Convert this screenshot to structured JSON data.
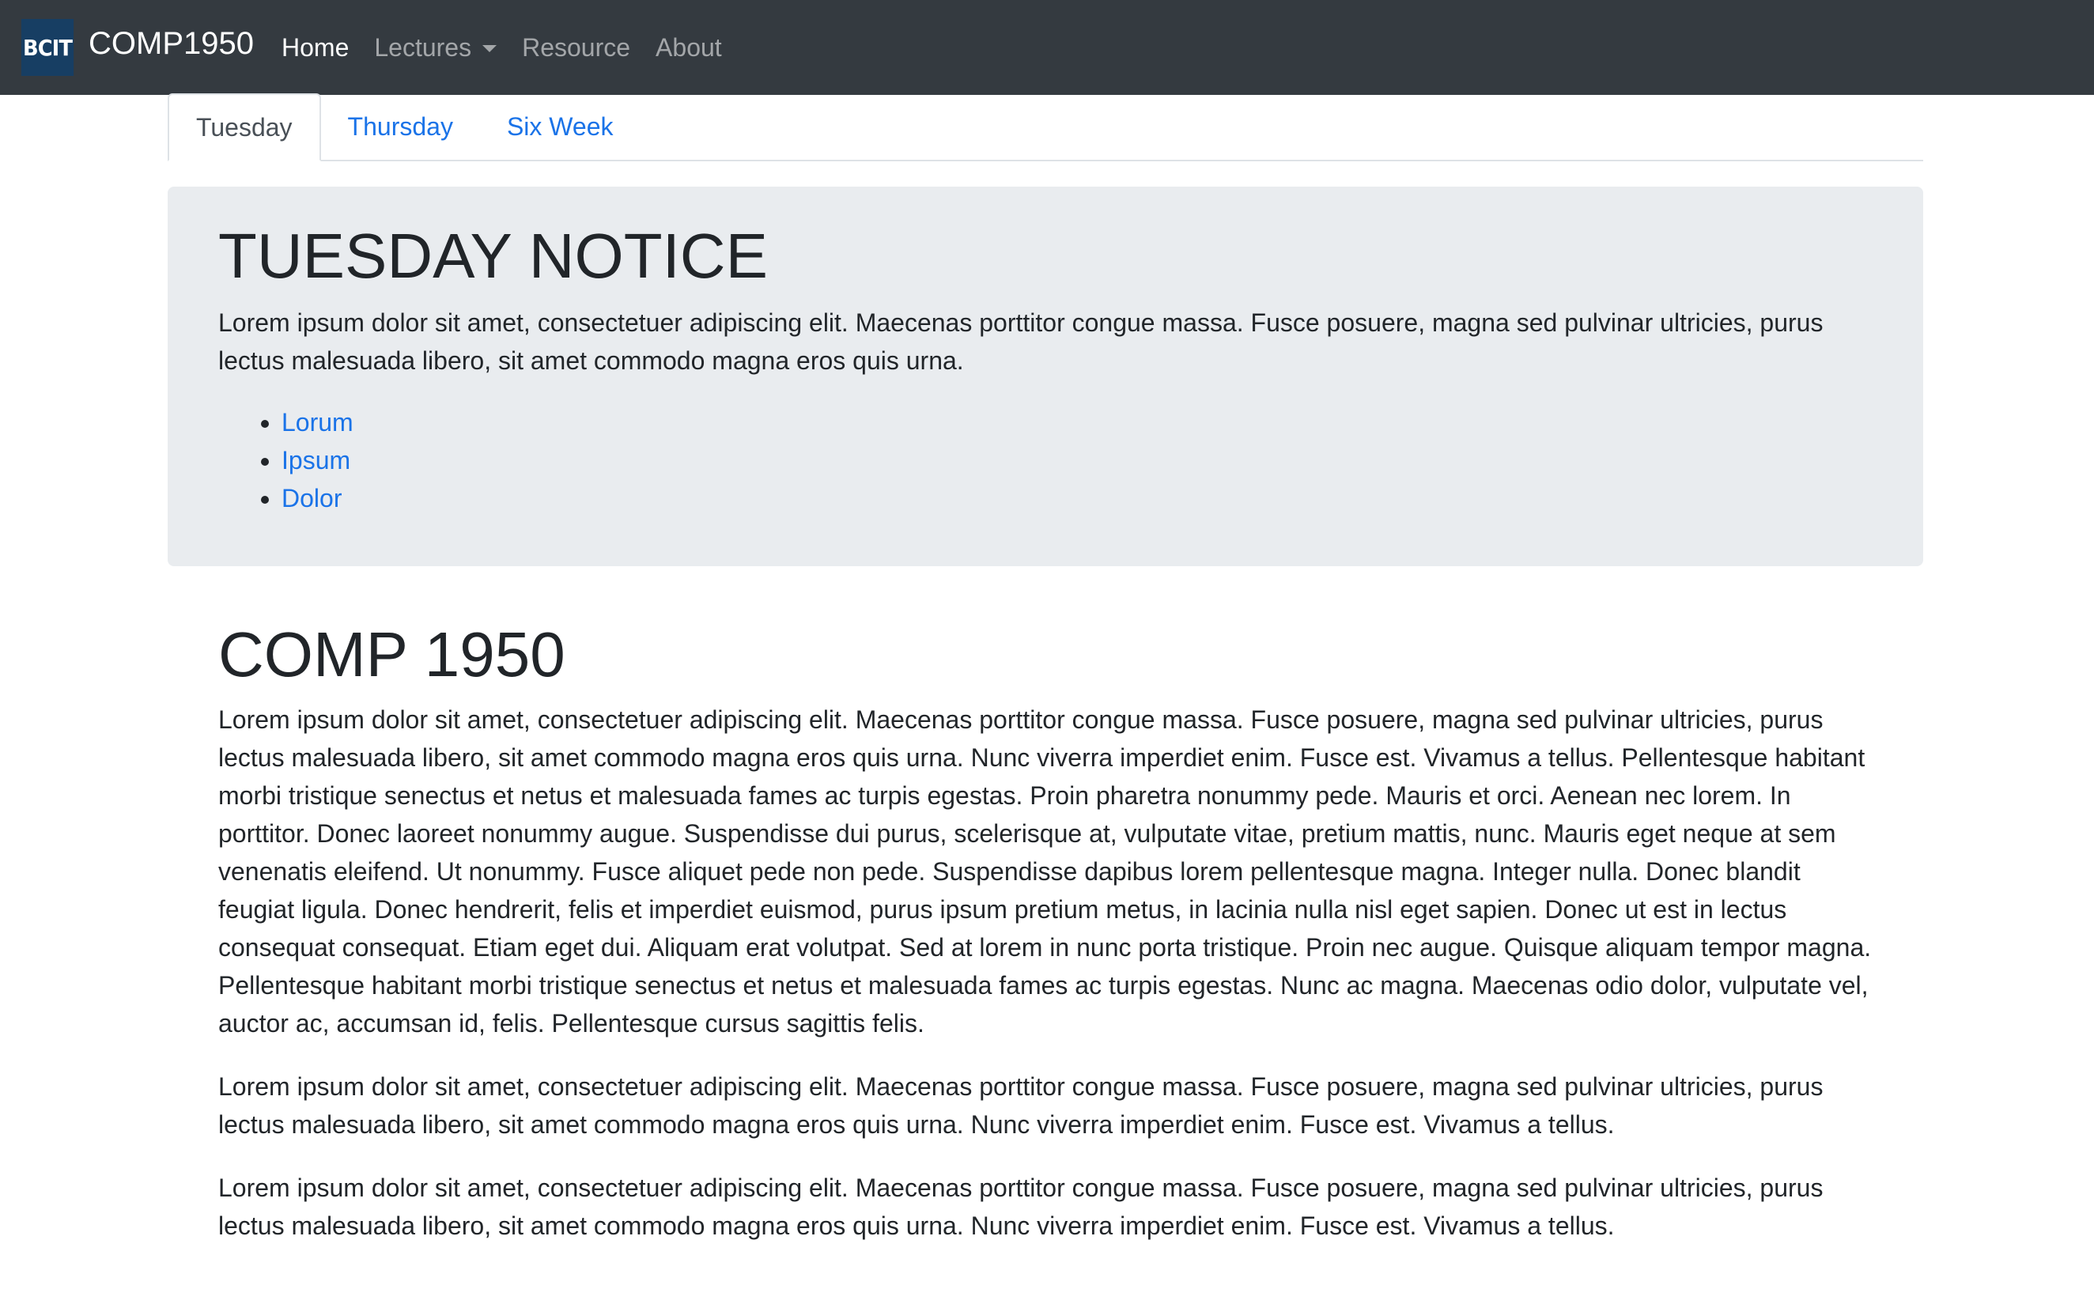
{
  "navbar": {
    "logo_text": "BCIT",
    "brand": "COMP1950",
    "links": [
      {
        "label": "Home"
      },
      {
        "label": "Lectures"
      },
      {
        "label": "Resource"
      },
      {
        "label": "About"
      }
    ],
    "colors": {
      "background": "#343a40",
      "logo_bg": "#173e63"
    }
  },
  "tabs": [
    {
      "label": "Tuesday"
    },
    {
      "label": "Thursday"
    },
    {
      "label": "Six Week"
    }
  ],
  "notice": {
    "title": "TUESDAY NOTICE",
    "text": "Lorem ipsum dolor sit amet, consectetuer adipiscing elit. Maecenas porttitor congue massa. Fusce posuere, magna sed pulvinar ultricies, purus lectus malesuada libero, sit amet commodo magna eros quis urna.",
    "links": [
      "Lorum",
      "Ipsum",
      "Dolor"
    ],
    "background": "#e9ecef"
  },
  "main": {
    "title": "COMP 1950",
    "paragraphs": [
      "Lorem ipsum dolor sit amet, consectetuer adipiscing elit. Maecenas porttitor congue massa. Fusce posuere, magna sed pulvinar ultricies, purus lectus malesuada libero, sit amet commodo magna eros quis urna. Nunc viverra imperdiet enim. Fusce est. Vivamus a tellus. Pellentesque habitant morbi tristique senectus et netus et malesuada fames ac turpis egestas. Proin pharetra nonummy pede. Mauris et orci. Aenean nec lorem. In porttitor. Donec laoreet nonummy augue. Suspendisse dui purus, scelerisque at, vulputate vitae, pretium mattis, nunc. Mauris eget neque at sem venenatis eleifend. Ut nonummy. Fusce aliquet pede non pede. Suspendisse dapibus lorem pellentesque magna. Integer nulla. Donec blandit feugiat ligula. Donec hendrerit, felis et imperdiet euismod, purus ipsum pretium metus, in lacinia nulla nisl eget sapien. Donec ut est in lectus consequat consequat. Etiam eget dui. Aliquam erat volutpat. Sed at lorem in nunc porta tristique. Proin nec augue. Quisque aliquam tempor magna. Pellentesque habitant morbi tristique senectus et netus et malesuada fames ac turpis egestas. Nunc ac magna. Maecenas odio dolor, vulputate vel, auctor ac, accumsan id, felis. Pellentesque cursus sagittis felis.",
      "Lorem ipsum dolor sit amet, consectetuer adipiscing elit. Maecenas porttitor congue massa. Fusce posuere, magna sed pulvinar ultricies, purus lectus malesuada libero, sit amet commodo magna eros quis urna. Nunc viverra imperdiet enim. Fusce est. Vivamus a tellus.",
      "Lorem ipsum dolor sit amet, consectetuer adipiscing elit. Maecenas porttitor congue massa. Fusce posuere, magna sed pulvinar ultricies, purus lectus malesuada libero, sit amet commodo magna eros quis urna. Nunc viverra imperdiet enim. Fusce est. Vivamus a tellus."
    ]
  },
  "colors": {
    "link": "#1a73e8",
    "text": "#212529"
  }
}
